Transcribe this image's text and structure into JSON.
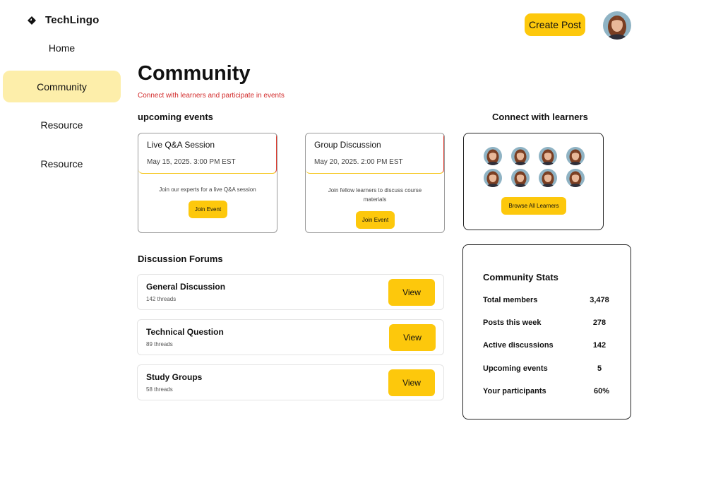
{
  "app": {
    "name": "TechLingo"
  },
  "sidebar": {
    "items": [
      {
        "label": "Home"
      },
      {
        "label": "Community"
      },
      {
        "label": "Resource"
      },
      {
        "label": "Resource"
      }
    ]
  },
  "header": {
    "create_post_label": "Create Post"
  },
  "page": {
    "title": "Community",
    "subtitle": "Connect with learners and participate in events"
  },
  "events": {
    "heading": "upcoming events",
    "items": [
      {
        "title": "Live Q&A Session",
        "date": "May 15, 2025. 3:00 PM EST",
        "description": "Join our experts for a live Q&A session",
        "button_label": "Join Event"
      },
      {
        "title": "Group Discussion",
        "date": "May 20, 2025. 2:00 PM EST",
        "description": "Join fellow learners to discuss course materials",
        "button_label": "Join Event"
      }
    ]
  },
  "learners": {
    "heading": "Connect with learners",
    "browse_label": "Browse All Learners"
  },
  "forums": {
    "heading": "Discussion Forums",
    "items": [
      {
        "title": "General Discussion",
        "threads": "142 threads",
        "button_label": "View"
      },
      {
        "title": "Technical Question",
        "threads": "89 threads",
        "button_label": "View"
      },
      {
        "title": "Study Groups",
        "threads": "58 threads",
        "button_label": "View"
      }
    ]
  },
  "stats": {
    "title": "Community Stats",
    "rows": [
      {
        "label": "Total members",
        "value": "3,478"
      },
      {
        "label": "Posts this week",
        "value": "278"
      },
      {
        "label": "Active discussions",
        "value": "142"
      },
      {
        "label": "Upcoming events",
        "value": "5"
      },
      {
        "label": "Your participants",
        "value": "60%"
      }
    ]
  },
  "colors": {
    "accent": "#fdc80c",
    "active_nav": "#fdeeaa",
    "subtitle_red": "#d22a2a"
  }
}
